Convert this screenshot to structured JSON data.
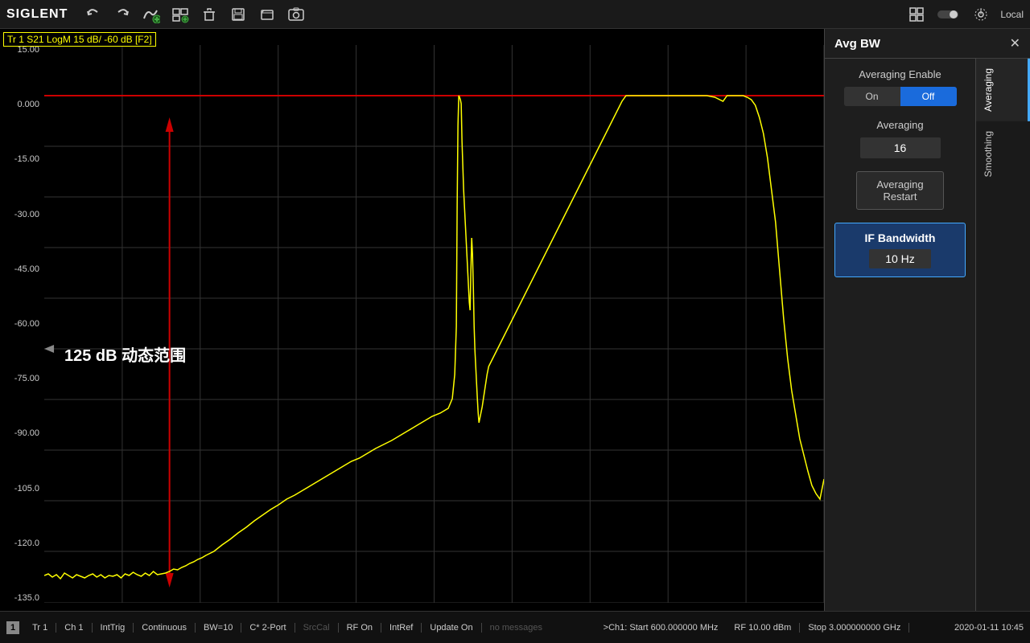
{
  "toolbar": {
    "logo": "SIGLENT",
    "local_label": "Local",
    "buttons": [
      "undo",
      "redo",
      "add-trace",
      "add-window",
      "add-marker",
      "save",
      "load",
      "screenshot"
    ]
  },
  "trace_label": "Tr 1  S21 LogM  15 dB/  -60 dB  [F2]",
  "y_axis": {
    "labels": [
      "15.00",
      "0.000",
      "-15.00",
      "-30.00",
      "-45.00",
      "-60.00",
      "-75.00",
      "-90.00",
      "-105.0",
      "-120.0",
      "-135.0"
    ]
  },
  "annotation": "125 dB 动态范围",
  "right_panel": {
    "title": "Avg BW",
    "tabs": [
      "Averaging",
      "Smoothing"
    ],
    "active_tab": "Averaging",
    "sections": {
      "averaging_enable": {
        "label": "Averaging Enable",
        "on_label": "On",
        "off_label": "Off",
        "active": "Off"
      },
      "averaging": {
        "label": "Averaging",
        "value": "16"
      },
      "averaging_restart": {
        "label": "Averaging\nRestart"
      },
      "if_bandwidth": {
        "label": "IF Bandwidth",
        "value": "10 Hz"
      }
    }
  },
  "status_bar": {
    "ch_number": "1",
    "tr_label": "Tr 1",
    "ch_label": "Ch 1",
    "int_trig": "IntTrig",
    "continuous": "Continuous",
    "bw": "BW=10",
    "port": "C* 2-Port",
    "src_cal": "SrcCal",
    "rf_on": "RF On",
    "int_ref": "IntRef",
    "update_on": "Update On",
    "no_messages": "no messages",
    "freq_info": ">Ch1: Start 600.000000 MHz",
    "rf_power": "RF 10.00 dBm",
    "stop_freq": "Stop 3.000000000 GHz",
    "datetime": "2020-01-11  10:45"
  }
}
